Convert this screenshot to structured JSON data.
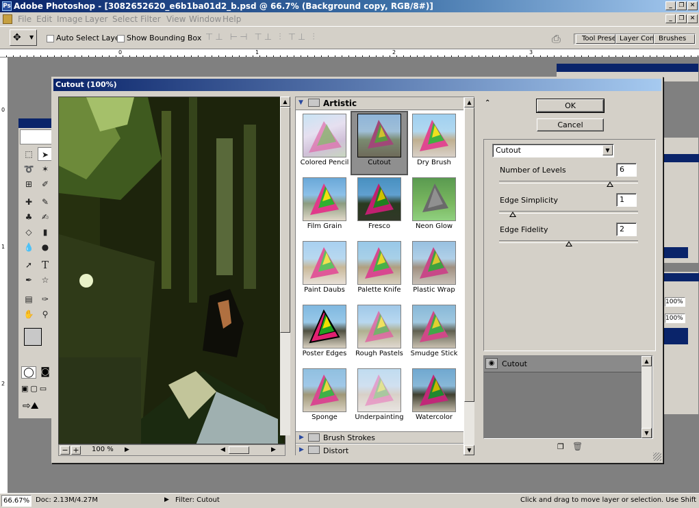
{
  "window": {
    "title": "Adobe Photoshop - [3082652620_e6b1ba01d2_b.psd @ 66.7% (Background copy, RGB/8#)]",
    "minimize": "_",
    "restore": "❐",
    "close": "✕"
  },
  "menu": [
    "File",
    "Edit",
    "Image",
    "Layer",
    "Select",
    "Filter",
    "View",
    "Window",
    "Help"
  ],
  "options": {
    "auto_select": "Auto Select Layer",
    "show_bbox": "Show Bounding Box",
    "tabs": [
      "Tool Prese",
      "Layer Com",
      "Brushes"
    ]
  },
  "ruler": {
    "h": [
      "0",
      "1",
      "2",
      "3"
    ],
    "v": [
      "0",
      "1",
      "2"
    ]
  },
  "dialog": {
    "title": "Cutout (100%)",
    "ok": "OK",
    "cancel": "Cancel",
    "zoom": "100 %",
    "zoom_minus": "−",
    "zoom_plus": "+",
    "category_open": "Artistic",
    "categories_closed": [
      "Brush Strokes",
      "Distort"
    ],
    "filters": [
      "Colored Pencil",
      "Cutout",
      "Dry Brush",
      "Film Grain",
      "Fresco",
      "Neon Glow",
      "Paint Daubs",
      "Palette Knife",
      "Plastic Wrap",
      "Poster Edges",
      "Rough Pastels",
      "Smudge Stick",
      "Sponge",
      "Underpainting",
      "Watercolor"
    ],
    "selected_filter": "Cutout",
    "filter_dropdown": "Cutout",
    "params": [
      {
        "label": "Number of Levels",
        "value": "6",
        "fraction": 0.8
      },
      {
        "label": "Edge Simplicity",
        "value": "1",
        "fraction": 0.1
      },
      {
        "label": "Edge Fidelity",
        "value": "2",
        "fraction": 0.5
      }
    ],
    "layer_name": "Cutout"
  },
  "side_panels": {
    "zoom1": "100%",
    "zoom2": "100%"
  },
  "status": {
    "zoom": "66.67%",
    "doc": "Doc: 2.13M/4.27M",
    "filter": "Filter: Cutout",
    "hint": "Click and drag to move layer or selection.  Use Shift and A"
  }
}
